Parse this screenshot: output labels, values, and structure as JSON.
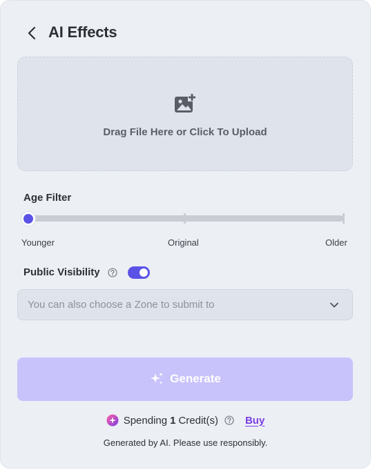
{
  "header": {
    "title": "AI Effects"
  },
  "upload": {
    "text": "Drag File Here or Click To Upload",
    "icon": "add-image-icon"
  },
  "age_filter": {
    "label": "Age Filter",
    "ticks": [
      "Younger",
      "Original",
      "Older"
    ],
    "selected": "Younger",
    "value_fraction": 0
  },
  "visibility": {
    "label": "Public Visibility",
    "enabled": true
  },
  "zone": {
    "placeholder": "You can also choose a Zone to submit to"
  },
  "generate": {
    "label": "Generate",
    "enabled": false
  },
  "credits": {
    "prefix": "Spending",
    "amount": "1",
    "suffix": "Credit(s)",
    "buy_label": "Buy"
  },
  "disclaimer": "Generated by AI. Please use responsibly.",
  "colors": {
    "accent": "#5b53e6",
    "generate_disabled": "#c8c3fb",
    "buy_link": "#7b3fe4",
    "panel_bg": "#eceff4"
  }
}
